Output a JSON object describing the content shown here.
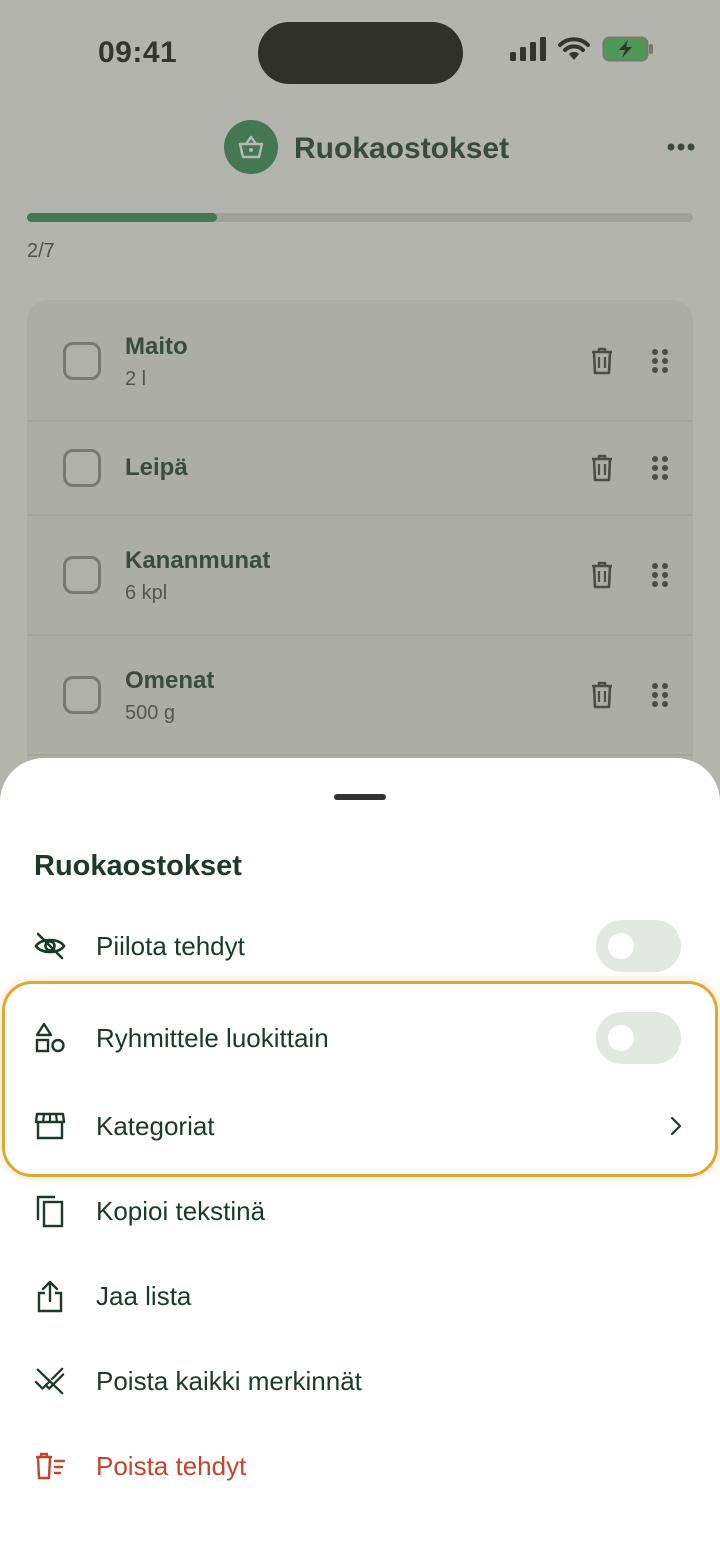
{
  "status_bar": {
    "time": "09:41"
  },
  "header": {
    "title": "Ruokaostokset",
    "icon": "basket-icon",
    "more_icon": "more-horizontal-icon"
  },
  "progress": {
    "text": "2/7",
    "fraction": 0.2857
  },
  "items": [
    {
      "name": "Maito",
      "quantity": "2 l"
    },
    {
      "name": "Leipä",
      "quantity": ""
    },
    {
      "name": "Kananmunat",
      "quantity": "6 kpl"
    },
    {
      "name": "Omenat",
      "quantity": "500 g"
    }
  ],
  "sheet": {
    "title": "Ruokaostokset",
    "options": [
      {
        "label": "Piilota tehdyt",
        "icon": "eye-off-icon",
        "control": "toggle",
        "on": false
      },
      {
        "label": "Ryhmittele luokittain",
        "icon": "shapes-icon",
        "control": "toggle",
        "on": false
      },
      {
        "label": "Kategoriat",
        "icon": "store-icon",
        "control": "chevron"
      },
      {
        "label": "Kopioi tekstinä",
        "icon": "copy-icon",
        "control": "none"
      },
      {
        "label": "Jaa lista",
        "icon": "share-icon",
        "control": "none"
      },
      {
        "label": "Poista kaikki merkinnät",
        "icon": "check-off-icon",
        "control": "none"
      },
      {
        "label": "Poista tehdyt",
        "icon": "delete-list-icon",
        "control": "none",
        "danger": true
      }
    ]
  },
  "colors": {
    "accent": "#2e8a55",
    "text": "#1b3a2a",
    "danger": "#c2452d",
    "highlight": "#e0a733",
    "toggle_off": "#e3e8e2"
  }
}
